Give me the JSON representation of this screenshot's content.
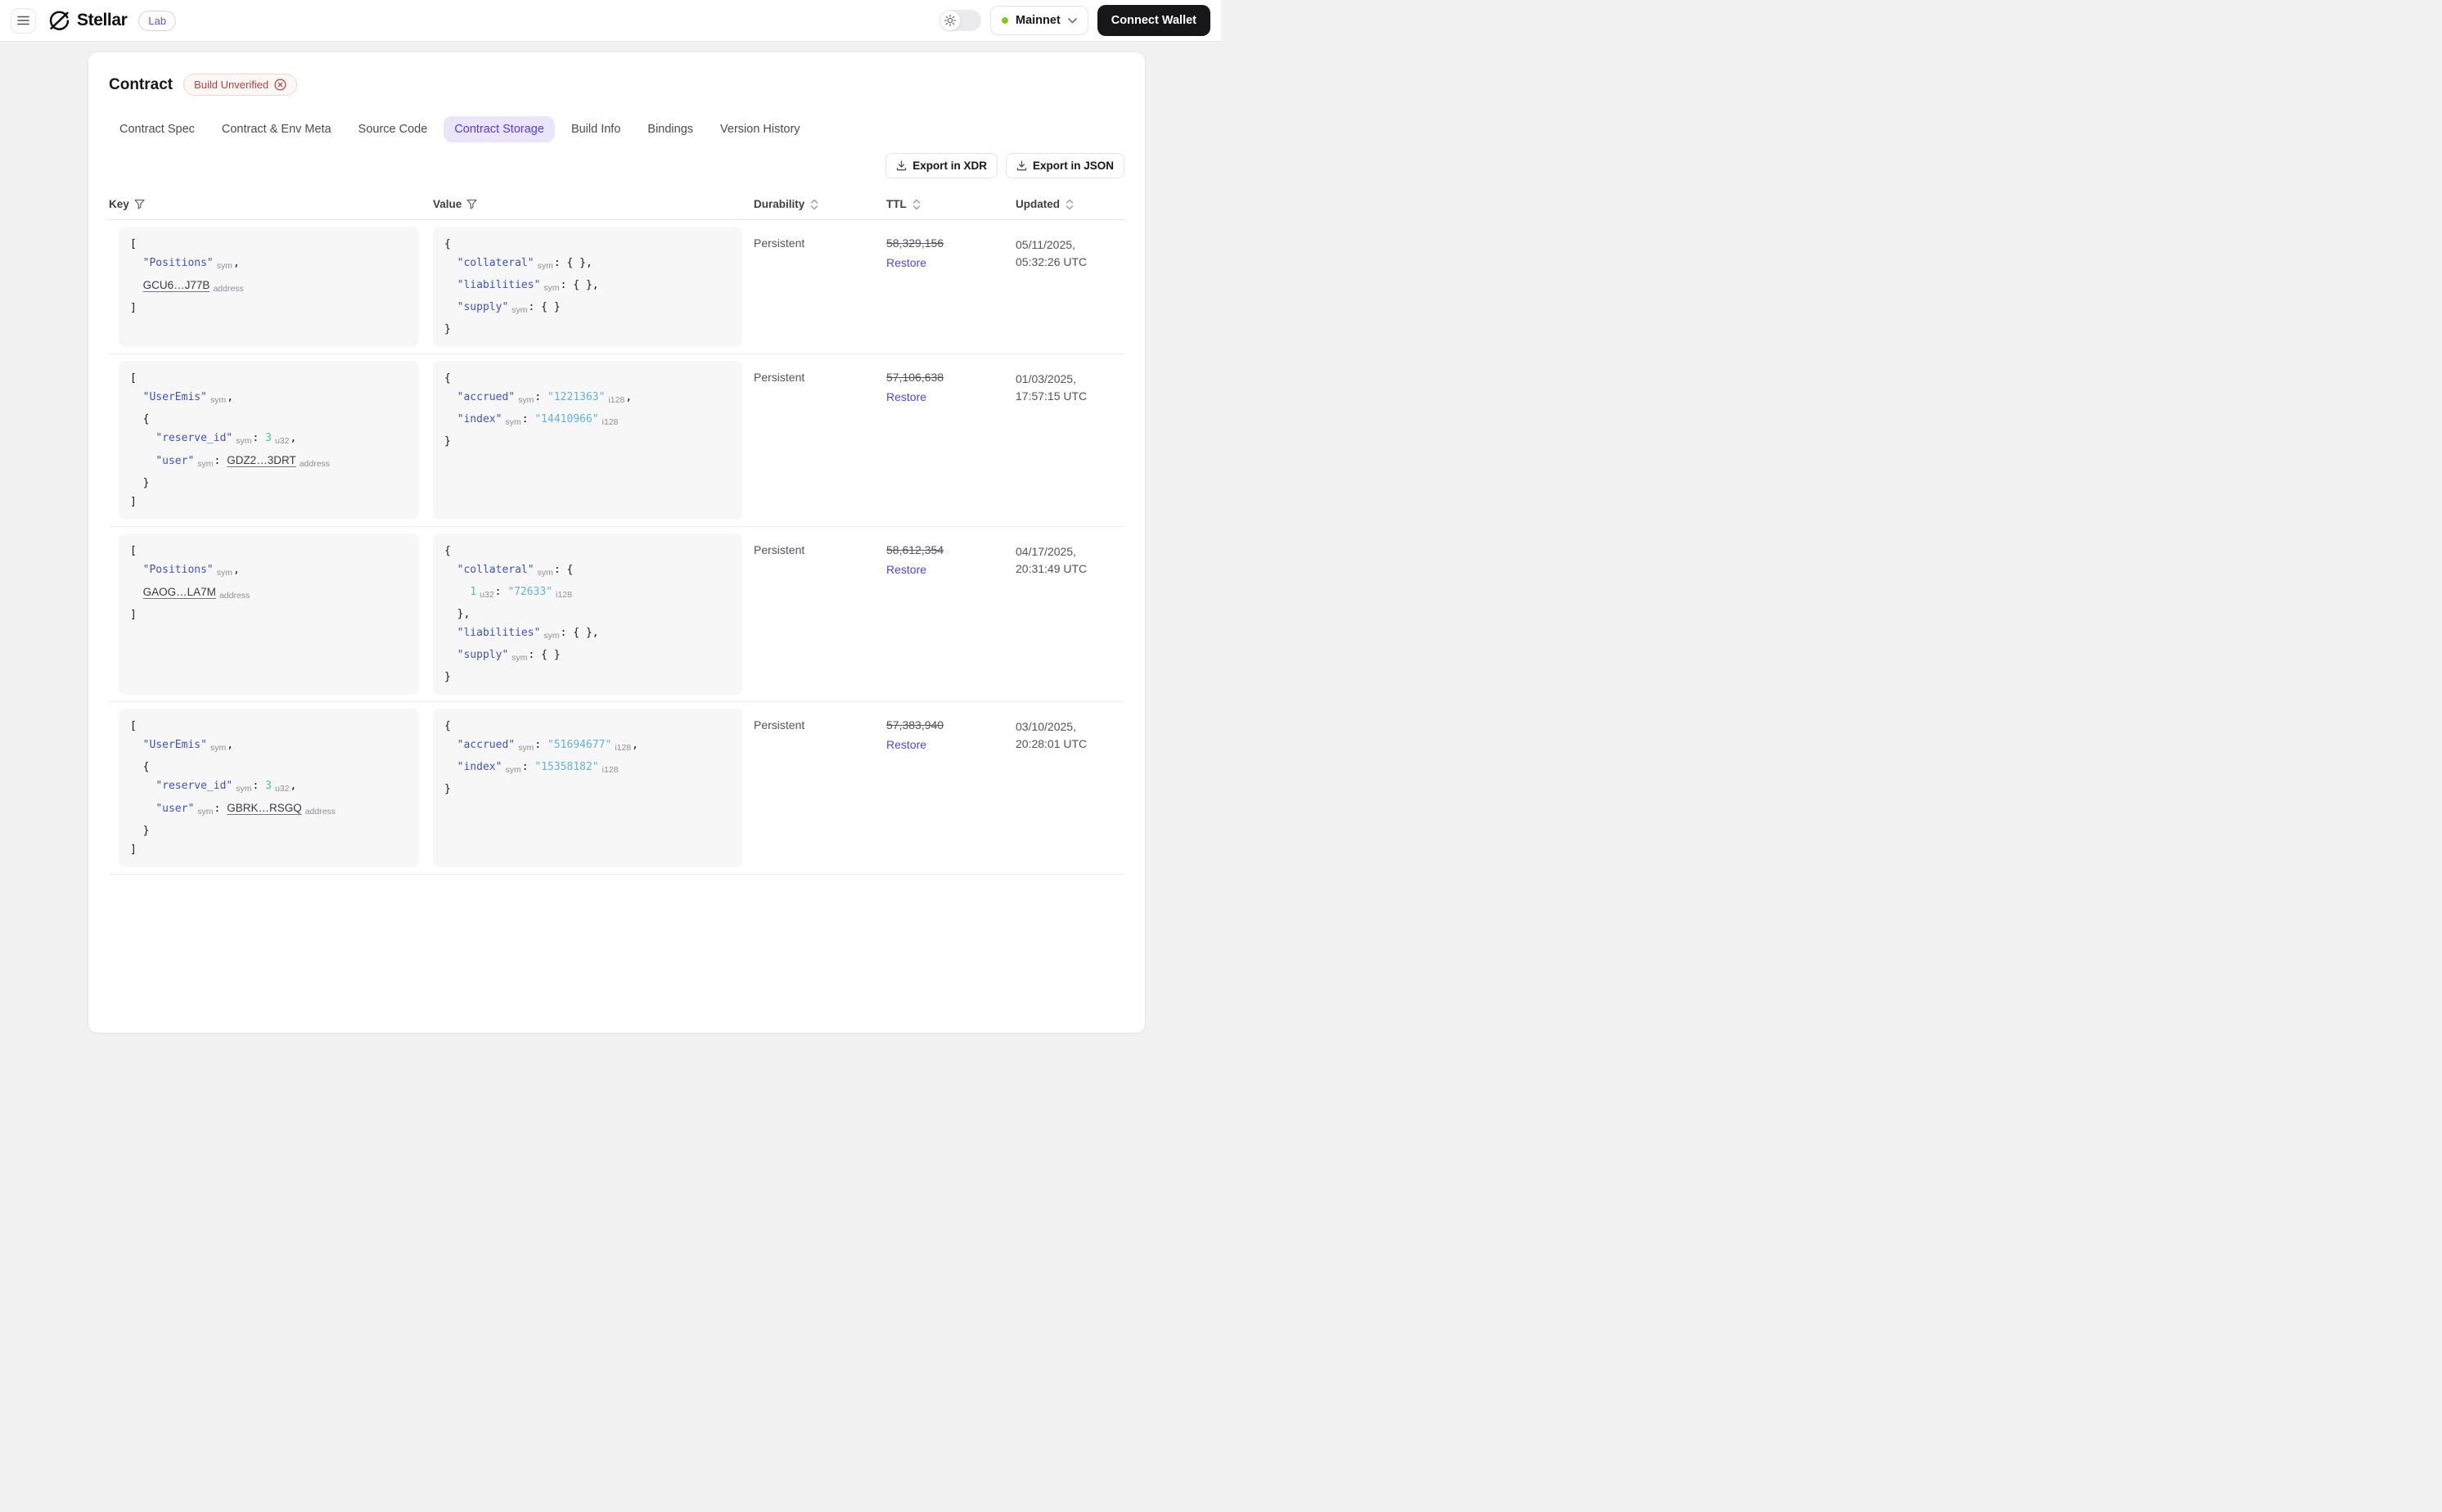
{
  "header": {
    "brand": "Stellar",
    "lab_badge": "Lab",
    "network": "Mainnet",
    "connect_wallet": "Connect Wallet"
  },
  "page": {
    "title": "Contract",
    "status_badge": "Build Unverified"
  },
  "tabs": [
    {
      "label": "Contract Spec",
      "active": false
    },
    {
      "label": "Contract & Env Meta",
      "active": false
    },
    {
      "label": "Source Code",
      "active": false
    },
    {
      "label": "Contract Storage",
      "active": true
    },
    {
      "label": "Build Info",
      "active": false
    },
    {
      "label": "Bindings",
      "active": false
    },
    {
      "label": "Version History",
      "active": false
    }
  ],
  "toolbar": {
    "export_xdr": "Export in XDR",
    "export_json": "Export in JSON"
  },
  "table": {
    "columns": [
      {
        "label": "Key",
        "icon": "filter"
      },
      {
        "label": "Value",
        "icon": "filter"
      },
      {
        "label": "Durability",
        "icon": "sort"
      },
      {
        "label": "TTL",
        "icon": "sort"
      },
      {
        "label": "Updated",
        "icon": "sort"
      }
    ],
    "rows": [
      {
        "key_lines": [
          [
            [
              "p",
              "["
            ]
          ],
          [
            [
              "p",
              "  "
            ],
            [
              "k",
              "\"Positions\""
            ],
            [
              "l",
              "sym"
            ],
            [
              "p",
              ","
            ]
          ],
          [
            [
              "p",
              "  "
            ],
            [
              "a",
              "GCU6…J77B"
            ],
            [
              "l",
              "address"
            ]
          ],
          [
            [
              "p",
              "]"
            ]
          ]
        ],
        "value_lines": [
          [
            [
              "p",
              "{"
            ]
          ],
          [
            [
              "p",
              "  "
            ],
            [
              "k",
              "\"collateral\""
            ],
            [
              "l",
              "sym"
            ],
            [
              "p",
              ": { },"
            ]
          ],
          [
            [
              "p",
              "  "
            ],
            [
              "k",
              "\"liabilities\""
            ],
            [
              "l",
              "sym"
            ],
            [
              "p",
              ": { },"
            ]
          ],
          [
            [
              "p",
              "  "
            ],
            [
              "k",
              "\"supply\""
            ],
            [
              "l",
              "sym"
            ],
            [
              "p",
              ": { }"
            ]
          ],
          [
            [
              "p",
              "}"
            ]
          ]
        ],
        "durability": "Persistent",
        "ttl": "58,329,156",
        "restore": "Restore",
        "updated_date": "05/11/2025,",
        "updated_time": "05:32:26 UTC"
      },
      {
        "key_lines": [
          [
            [
              "p",
              "["
            ]
          ],
          [
            [
              "p",
              "  "
            ],
            [
              "k",
              "\"UserEmis\""
            ],
            [
              "l",
              "sym"
            ],
            [
              "p",
              ","
            ]
          ],
          [
            [
              "p",
              "  {"
            ]
          ],
          [
            [
              "p",
              "    "
            ],
            [
              "k",
              "\"reserve_id\""
            ],
            [
              "l",
              "sym"
            ],
            [
              "p",
              ": "
            ],
            [
              "n",
              "3"
            ],
            [
              "l",
              "u32"
            ],
            [
              "p",
              ","
            ]
          ],
          [
            [
              "p",
              "    "
            ],
            [
              "k",
              "\"user\""
            ],
            [
              "l",
              "sym"
            ],
            [
              "p",
              ": "
            ],
            [
              "a",
              "GDZ2…3DRT"
            ],
            [
              "l",
              "address"
            ]
          ],
          [
            [
              "p",
              "  }"
            ]
          ],
          [
            [
              "p",
              "]"
            ]
          ]
        ],
        "value_lines": [
          [
            [
              "p",
              "{"
            ]
          ],
          [
            [
              "p",
              "  "
            ],
            [
              "k",
              "\"accrued\""
            ],
            [
              "l",
              "sym"
            ],
            [
              "p",
              ": "
            ],
            [
              "s",
              "\"1221363\""
            ],
            [
              "l",
              "i128"
            ],
            [
              "p",
              ","
            ]
          ],
          [
            [
              "p",
              "  "
            ],
            [
              "k",
              "\"index\""
            ],
            [
              "l",
              "sym"
            ],
            [
              "p",
              ": "
            ],
            [
              "s",
              "\"14410966\""
            ],
            [
              "l",
              "i128"
            ]
          ],
          [
            [
              "p",
              "}"
            ]
          ]
        ],
        "durability": "Persistent",
        "ttl": "57,106,638",
        "restore": "Restore",
        "updated_date": "01/03/2025,",
        "updated_time": "17:57:15 UTC"
      },
      {
        "key_lines": [
          [
            [
              "p",
              "["
            ]
          ],
          [
            [
              "p",
              "  "
            ],
            [
              "k",
              "\"Positions\""
            ],
            [
              "l",
              "sym"
            ],
            [
              "p",
              ","
            ]
          ],
          [
            [
              "p",
              "  "
            ],
            [
              "a",
              "GAOG…LA7M"
            ],
            [
              "l",
              "address"
            ]
          ],
          [
            [
              "p",
              "]"
            ]
          ]
        ],
        "value_lines": [
          [
            [
              "p",
              "{"
            ]
          ],
          [
            [
              "p",
              "  "
            ],
            [
              "k",
              "\"collateral\""
            ],
            [
              "l",
              "sym"
            ],
            [
              "p",
              ": {"
            ]
          ],
          [
            [
              "p",
              "    "
            ],
            [
              "n",
              "1"
            ],
            [
              "l",
              "u32"
            ],
            [
              "p",
              ": "
            ],
            [
              "s",
              "\"72633\""
            ],
            [
              "l",
              "i128"
            ]
          ],
          [
            [
              "p",
              "  },"
            ]
          ],
          [
            [
              "p",
              "  "
            ],
            [
              "k",
              "\"liabilities\""
            ],
            [
              "l",
              "sym"
            ],
            [
              "p",
              ": { },"
            ]
          ],
          [
            [
              "p",
              "  "
            ],
            [
              "k",
              "\"supply\""
            ],
            [
              "l",
              "sym"
            ],
            [
              "p",
              ": { }"
            ]
          ],
          [
            [
              "p",
              "}"
            ]
          ]
        ],
        "durability": "Persistent",
        "ttl": "58,612,354",
        "restore": "Restore",
        "updated_date": "04/17/2025,",
        "updated_time": "20:31:49 UTC"
      },
      {
        "key_lines": [
          [
            [
              "p",
              "["
            ]
          ],
          [
            [
              "p",
              "  "
            ],
            [
              "k",
              "\"UserEmis\""
            ],
            [
              "l",
              "sym"
            ],
            [
              "p",
              ","
            ]
          ],
          [
            [
              "p",
              "  {"
            ]
          ],
          [
            [
              "p",
              "    "
            ],
            [
              "k",
              "\"reserve_id\""
            ],
            [
              "l",
              "sym"
            ],
            [
              "p",
              ": "
            ],
            [
              "n",
              "3"
            ],
            [
              "l",
              "u32"
            ],
            [
              "p",
              ","
            ]
          ],
          [
            [
              "p",
              "    "
            ],
            [
              "k",
              "\"user\""
            ],
            [
              "l",
              "sym"
            ],
            [
              "p",
              ": "
            ],
            [
              "a",
              "GBRK…RSGQ"
            ],
            [
              "l",
              "address"
            ]
          ],
          [
            [
              "p",
              "  }"
            ]
          ],
          [
            [
              "p",
              "]"
            ]
          ]
        ],
        "value_lines": [
          [
            [
              "p",
              "{"
            ]
          ],
          [
            [
              "p",
              "  "
            ],
            [
              "k",
              "\"accrued\""
            ],
            [
              "l",
              "sym"
            ],
            [
              "p",
              ": "
            ],
            [
              "s",
              "\"51694677\""
            ],
            [
              "l",
              "i128"
            ],
            [
              "p",
              ","
            ]
          ],
          [
            [
              "p",
              "  "
            ],
            [
              "k",
              "\"index\""
            ],
            [
              "l",
              "sym"
            ],
            [
              "p",
              ": "
            ],
            [
              "s",
              "\"15358182\""
            ],
            [
              "l",
              "i128"
            ]
          ],
          [
            [
              "p",
              "}"
            ]
          ]
        ],
        "durability": "Persistent",
        "ttl": "57,383,940",
        "restore": "Restore",
        "updated_date": "03/10/2025,",
        "updated_time": "20:28:01 UTC"
      }
    ]
  },
  "colors": {
    "accent_purple": "#5639e8",
    "tab_active_bg": "#ebe5fc",
    "badge_red": "#b2423c",
    "badge_red_bg": "#fdf7f6",
    "network_dot_green": "#84cc16",
    "code_key_blue": "#3b54c4",
    "code_string_cyan": "#62b2d4",
    "code_number_teal": "#43c9a2",
    "code_label_gray": "#8e8e96",
    "restore_purple": "#5343d6",
    "connect_btn_black": "#17171a",
    "code_block_bg": "#f7f7f8"
  }
}
